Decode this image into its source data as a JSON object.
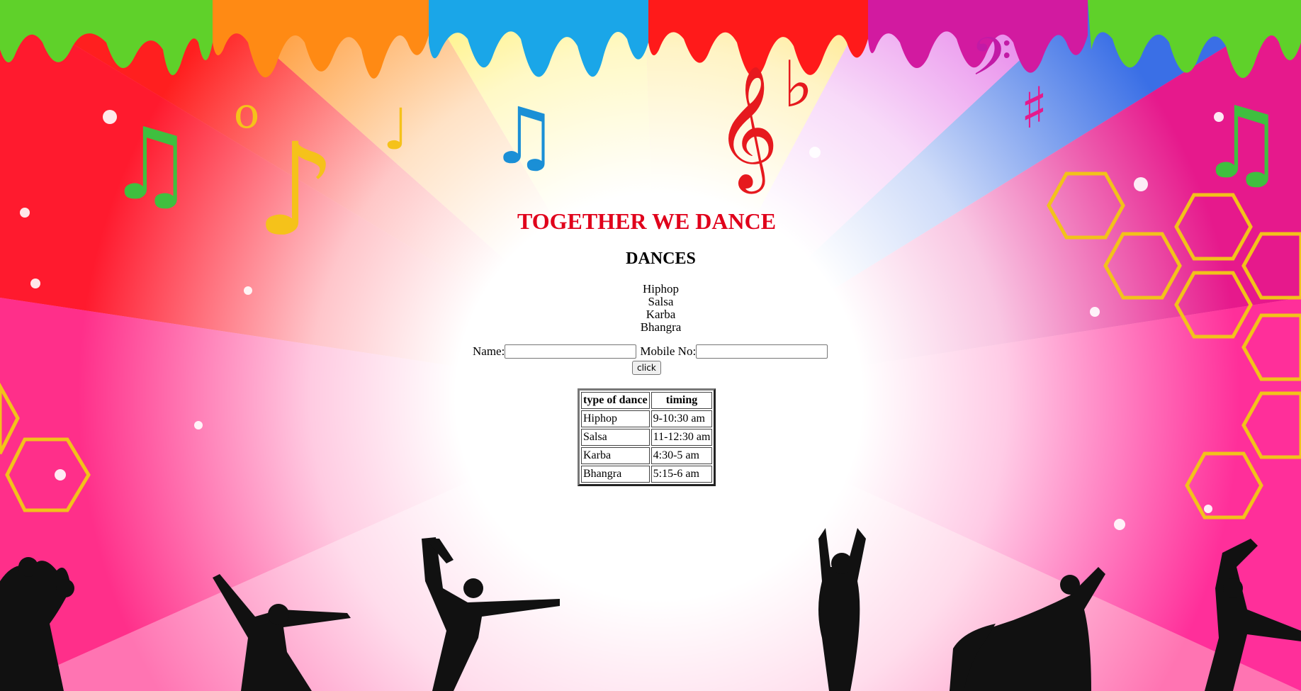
{
  "page": {
    "title": "TOGETHER WE DANCE",
    "title_color": "#e0001b",
    "subtitle": "DANCES"
  },
  "dances": [
    "Hiphop",
    "Salsa",
    "Karba",
    "Bhangra"
  ],
  "form": {
    "name_label": "Name:",
    "name_value": "",
    "mobile_label": "Mobile No:",
    "mobile_value": "",
    "submit_label": "click"
  },
  "table": {
    "headers": [
      "type of dance",
      "timing"
    ],
    "rows": [
      [
        "Hiphop",
        "9-10:30 am"
      ],
      [
        "Salsa",
        "11-12:30 am"
      ],
      [
        "Karba",
        "4:30-5 am"
      ],
      [
        "Bhangra",
        "5:15-6 am"
      ]
    ]
  },
  "background": {
    "theme": "colorful-dance-rays",
    "colors": [
      "#ff1a1a",
      "#ff8c00",
      "#ffe600",
      "#1fa3e6",
      "#e6007e",
      "#66cc33",
      "#ffffff"
    ],
    "silhouette_color": "#111111",
    "decorations": [
      "paint-drips",
      "music-notes",
      "hexagons",
      "sparkles",
      "dancer-silhouettes"
    ]
  }
}
